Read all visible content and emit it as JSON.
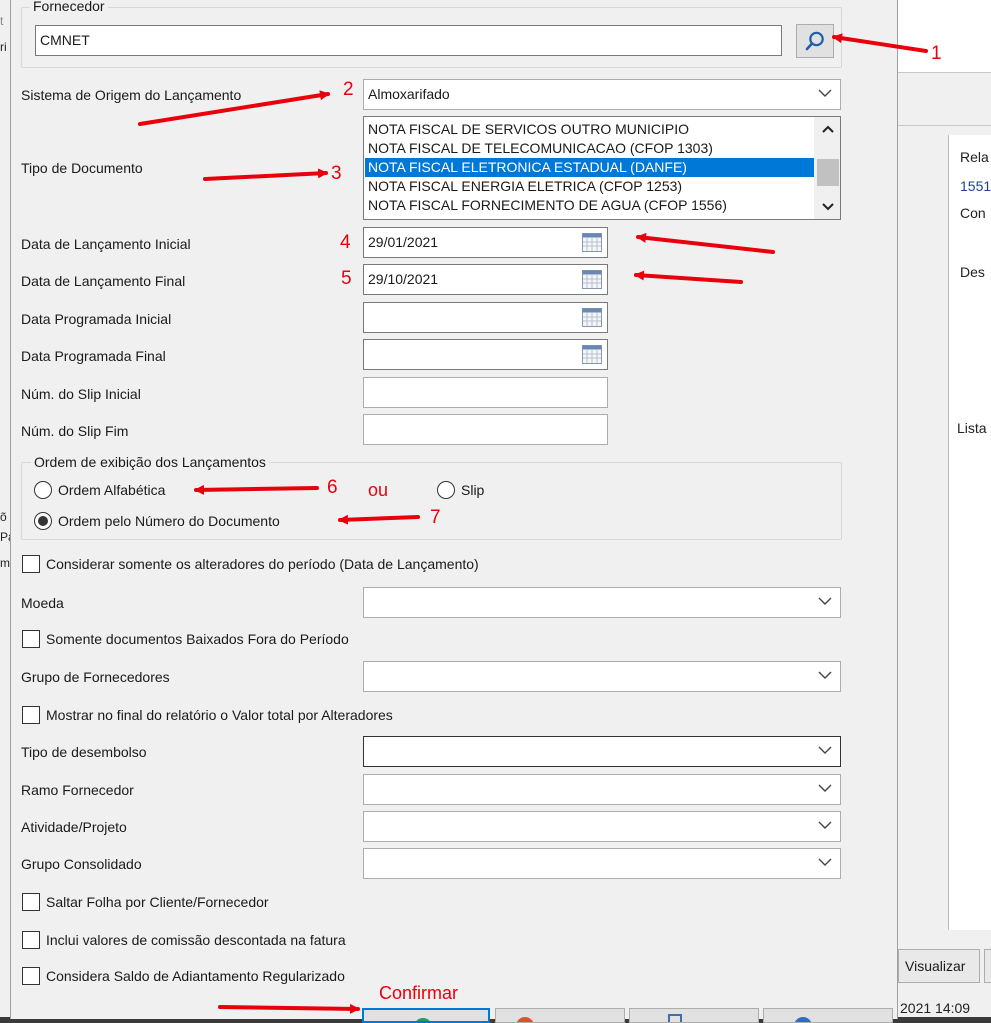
{
  "background": {
    "right_panel": {
      "rela": "Rela",
      "num": "1551",
      "con": "Con",
      "des": "Des",
      "lista": "Lista"
    },
    "left_edge_letters": [
      "t",
      "ri",
      "õ",
      "Pa",
      "m"
    ],
    "visualizar_label": "Visualizar",
    "timestamp": "2021 14:09"
  },
  "form": {
    "fornecedor": {
      "legend": "Fornecedor",
      "value": "CMNET",
      "search_icon": "search-icon"
    },
    "sistema_origem": {
      "label": "Sistema de Origem do Lançamento",
      "value": "Almoxarifado"
    },
    "tipo_documento": {
      "label": "Tipo de Documento",
      "items": [
        {
          "text": "NOTA FISCAL DE SERVICOS OUTRO MUNICIPIO",
          "selected": false
        },
        {
          "text": "NOTA FISCAL DE TELECOMUNICACAO (CFOP 1303)",
          "selected": false
        },
        {
          "text": "NOTA FISCAL ELETRONICA ESTADUAL (DANFE)",
          "selected": true
        },
        {
          "text": "NOTA FISCAL ENERGIA ELETRICA (CFOP 1253)",
          "selected": false
        },
        {
          "text": "NOTA FISCAL FORNECIMENTO DE AGUA (CFOP 1556)",
          "selected": false
        }
      ]
    },
    "data_lancamento_inicial": {
      "label": "Data de Lançamento Inicial",
      "value": "29/01/2021"
    },
    "data_lancamento_final": {
      "label": "Data de Lançamento Final",
      "value": "29/10/2021"
    },
    "data_programada_inicial": {
      "label": "Data Programada Inicial",
      "value": ""
    },
    "data_programada_final": {
      "label": "Data Programada Final",
      "value": ""
    },
    "num_slip_inicial": {
      "label": "Núm. do Slip Inicial",
      "value": ""
    },
    "num_slip_fim": {
      "label": "Núm. do Slip Fim",
      "value": ""
    },
    "ordem": {
      "legend": "Ordem de exibição dos Lançamentos",
      "options": [
        {
          "label": "Ordem Alfabética",
          "checked": false
        },
        {
          "label": "Slip",
          "checked": false
        },
        {
          "label": "Ordem pelo Número do Documento",
          "checked": true
        }
      ]
    },
    "considerar_alteradores": {
      "label": "Considerar somente os alteradores do período (Data de Lançamento)",
      "checked": false
    },
    "moeda": {
      "label": "Moeda",
      "value": ""
    },
    "somente_baixados": {
      "label": "Somente documentos Baixados Fora do Período",
      "checked": false
    },
    "grupo_fornecedores": {
      "label": "Grupo de Fornecedores",
      "value": ""
    },
    "mostrar_valor_total": {
      "label": "Mostrar no final do relatório o Valor total por Alteradores",
      "checked": false
    },
    "tipo_desembolso": {
      "label": "Tipo de desembolso",
      "value": ""
    },
    "ramo_fornecedor": {
      "label": "Ramo Fornecedor",
      "value": ""
    },
    "atividade_projeto": {
      "label": "Atividade/Projeto",
      "value": ""
    },
    "grupo_consolidado": {
      "label": "Grupo Consolidado",
      "value": ""
    },
    "saltar_folha": {
      "label": "Saltar Folha por Cliente/Fornecedor",
      "checked": false
    },
    "inclui_comissao": {
      "label": "Inclui valores de comissão descontada na fatura",
      "checked": false
    },
    "considera_saldo": {
      "label": "Considera Saldo de Adiantamento Regularizado",
      "checked": false
    }
  },
  "annotations": {
    "n1": "1",
    "n2": "2",
    "n3": "3",
    "n4": "4",
    "n5": "5",
    "n6": "6",
    "n7": "7",
    "ou": "ou",
    "confirmar": "Confirmar",
    "color": "#e8000d"
  }
}
